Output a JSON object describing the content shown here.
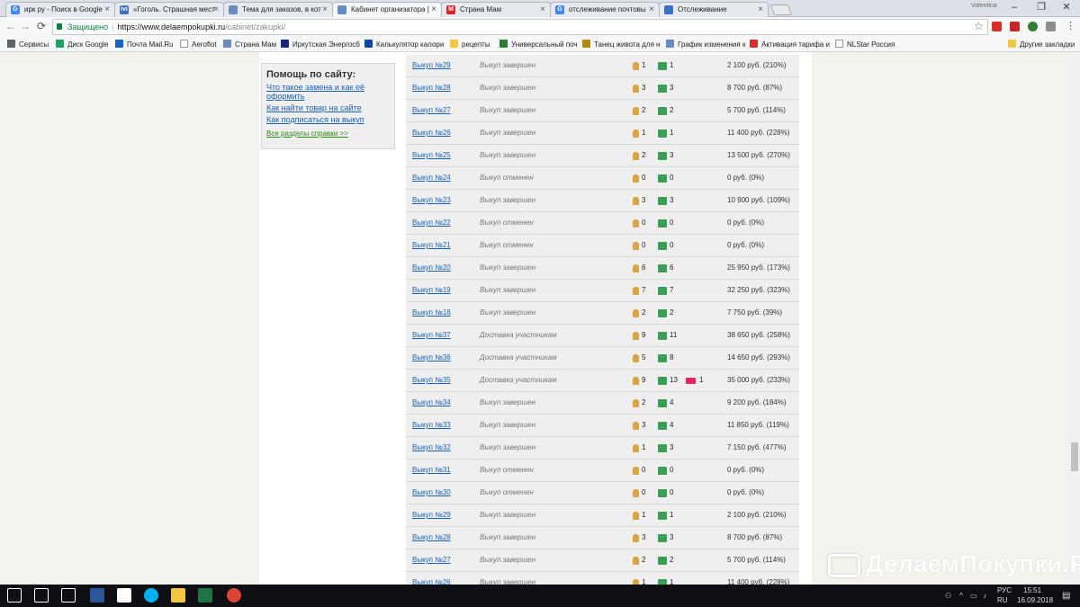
{
  "browser": {
    "tabs": [
      {
        "title": "ирк ру - Поиск в Google",
        "icon": "google-icon",
        "color": "#4285f4",
        "letter": "G"
      },
      {
        "title": "«Гоголь. Страшная мест",
        "icon": "kinopoisk-icon",
        "color": "#3b6fb6",
        "letter": "ivi"
      },
      {
        "title": "Тема для заказов, в кот",
        "icon": "page-icon",
        "color": "#6a8bbd",
        "letter": ""
      },
      {
        "title": "Кабинет организатора |",
        "icon": "page-icon",
        "color": "#6a8bbd",
        "letter": ""
      },
      {
        "title": "Страна Мам",
        "icon": "stranamam-icon",
        "color": "#d6262b",
        "letter": "M"
      },
      {
        "title": "отслеживание почтовы",
        "icon": "google-icon",
        "color": "#4285f4",
        "letter": "G"
      },
      {
        "title": "Отслеживание",
        "icon": "post-icon",
        "color": "#3a6fc4",
        "letter": ""
      }
    ],
    "active_tab": 3,
    "user_label": "Volentina",
    "url": {
      "secure_label": "Защищено",
      "host": "https://www.delaempokupki.ru",
      "path": "/cabinet/zakupki/"
    },
    "bookmarks": [
      {
        "label": "Сервисы",
        "color": "#5f6368"
      },
      {
        "label": "Диск Google",
        "color": "#1fa463"
      },
      {
        "label": "Почта Mail.Ru",
        "color": "#1565c0"
      },
      {
        "label": "Aeroflot",
        "color": "#ffffff"
      },
      {
        "label": "Страна Мам",
        "color": "#6a8bbd"
      },
      {
        "label": "Иркутская Энергосб",
        "color": "#1a237e"
      },
      {
        "label": "Калькулятор калори",
        "color": "#0d47a1"
      },
      {
        "label": "рецепты",
        "color": "#f2c744"
      },
      {
        "label": "Универсальный поч",
        "color": "#2e7d32"
      },
      {
        "label": "Танец живота для н",
        "color": "#b8860b"
      },
      {
        "label": "График изменения к",
        "color": "#6a8bbd"
      },
      {
        "label": "Активация тарифа и",
        "color": "#d32f2f"
      },
      {
        "label": "NLStar Россия",
        "color": "#ffffff"
      },
      {
        "label": "Другие закладки",
        "color": "#f2c744"
      }
    ]
  },
  "help": {
    "title": "Помощь по сайту:",
    "links": [
      "Что такое замена и как её оформить",
      "Как найти товар на сайте",
      "Как подписаться на выкуп"
    ],
    "all_link": "Все разделы справки >>"
  },
  "purchases": [
    {
      "name": "Выкуп №29",
      "status": "Выкуп завершен",
      "participants": "1",
      "orders": "1",
      "messages": "",
      "sum": "2 100 руб. (210%)"
    },
    {
      "name": "Выкуп №28",
      "status": "Выкуп завершен",
      "participants": "3",
      "orders": "3",
      "messages": "",
      "sum": "8 700 руб. (87%)"
    },
    {
      "name": "Выкуп №27",
      "status": "Выкуп завершен",
      "participants": "2",
      "orders": "2",
      "messages": "",
      "sum": "5 700 руб. (114%)"
    },
    {
      "name": "Выкуп №26",
      "status": "Выкуп завершен",
      "participants": "1",
      "orders": "1",
      "messages": "",
      "sum": "11 400 руб. (228%)"
    },
    {
      "name": "Выкуп №25",
      "status": "Выкуп завершен",
      "participants": "2",
      "orders": "3",
      "messages": "",
      "sum": "13 500 руб. (270%)"
    },
    {
      "name": "Выкуп №24",
      "status": "Выкуп отменен",
      "participants": "0",
      "orders": "0",
      "messages": "",
      "sum": "0 руб. (0%)"
    },
    {
      "name": "Выкуп №23",
      "status": "Выкуп завершен",
      "participants": "3",
      "orders": "3",
      "messages": "",
      "sum": "10 900 руб. (109%)"
    },
    {
      "name": "Выкуп №22",
      "status": "Выкуп отменен",
      "participants": "0",
      "orders": "0",
      "messages": "",
      "sum": "0 руб. (0%)"
    },
    {
      "name": "Выкуп №21",
      "status": "Выкуп отменен",
      "participants": "0",
      "orders": "0",
      "messages": "",
      "sum": "0 руб. (0%)"
    },
    {
      "name": "Выкуп №20",
      "status": "Выкуп завершен",
      "participants": "6",
      "orders": "6",
      "messages": "",
      "sum": "25 950 руб. (173%)"
    },
    {
      "name": "Выкуп №19",
      "status": "Выкуп завершен",
      "participants": "7",
      "orders": "7",
      "messages": "",
      "sum": "32 250 руб. (323%)"
    },
    {
      "name": "Выкуп №18",
      "status": "Выкуп завершен",
      "participants": "2",
      "orders": "2",
      "messages": "",
      "sum": "7 750 руб. (39%)"
    },
    {
      "name": "Выкуп №37",
      "status": "Доставка участникам",
      "participants": "9",
      "orders": "11",
      "messages": "",
      "sum": "38 650 руб. (258%)"
    },
    {
      "name": "Выкуп №36",
      "status": "Доставка участникам",
      "participants": "5",
      "orders": "8",
      "messages": "",
      "sum": "14 650 руб. (293%)"
    },
    {
      "name": "Выкуп №35",
      "status": "Доставка участникам",
      "participants": "9",
      "orders": "13",
      "messages": "1",
      "sum": "35 000 руб. (233%)"
    },
    {
      "name": "Выкуп №34",
      "status": "Выкуп завершен",
      "participants": "2",
      "orders": "4",
      "messages": "",
      "sum": "9 200 руб. (184%)"
    },
    {
      "name": "Выкуп №33",
      "status": "Выкуп завершен",
      "participants": "3",
      "orders": "4",
      "messages": "",
      "sum": "11 850 руб. (119%)"
    },
    {
      "name": "Выкуп №32",
      "status": "Выкуп завершен",
      "participants": "1",
      "orders": "3",
      "messages": "",
      "sum": "7 150 руб. (477%)"
    },
    {
      "name": "Выкуп №31",
      "status": "Выкуп отменен",
      "participants": "0",
      "orders": "0",
      "messages": "",
      "sum": "0 руб. (0%)"
    },
    {
      "name": "Выкуп №30",
      "status": "Выкуп отменен",
      "participants": "0",
      "orders": "0",
      "messages": "",
      "sum": "0 руб. (0%)"
    },
    {
      "name": "Выкуп №29",
      "status": "Выкуп завершен",
      "participants": "1",
      "orders": "1",
      "messages": "",
      "sum": "2 100 руб. (210%)"
    },
    {
      "name": "Выкуп №28",
      "status": "Выкуп завершен",
      "participants": "3",
      "orders": "3",
      "messages": "",
      "sum": "8 700 руб. (87%)"
    },
    {
      "name": "Выкуп №27",
      "status": "Выкуп завершен",
      "participants": "2",
      "orders": "2",
      "messages": "",
      "sum": "5 700 руб. (114%)"
    },
    {
      "name": "Выкуп №26",
      "status": "Выкуп завершен",
      "participants": "1",
      "orders": "1",
      "messages": "",
      "sum": "11 400 руб. (228%)"
    }
  ],
  "watermark": "ДелаемПокупки.Ру",
  "taskbar": {
    "lang_top": "РУС",
    "lang_bottom": "RU",
    "time": "15:51",
    "date": "16.09.2018",
    "apps": [
      {
        "icon": "windows-start-icon",
        "color": "#ffffff"
      },
      {
        "icon": "search-icon",
        "color": "#ffffff"
      },
      {
        "icon": "task-view-icon",
        "color": "#ffffff"
      },
      {
        "icon": "word-icon",
        "color": "#2b579a"
      },
      {
        "icon": "mail-icon",
        "color": "#ffffff"
      },
      {
        "icon": "skype-icon",
        "color": "#00aff0"
      },
      {
        "icon": "file-explorer-icon",
        "color": "#f2c744"
      },
      {
        "icon": "excel-icon",
        "color": "#217346"
      },
      {
        "icon": "chrome-icon",
        "color": "#db4437"
      }
    ]
  }
}
